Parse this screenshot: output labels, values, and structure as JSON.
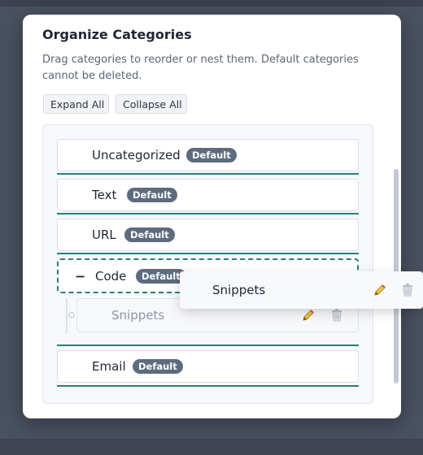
{
  "dialog": {
    "title": "Organize Categories",
    "description": "Drag categories to reorder or nest them. Default categories cannot be deleted.",
    "expand_all": "Expand All",
    "collapse_all": "Collapse All"
  },
  "categories": [
    {
      "name": "Uncategorized",
      "badge": "Default"
    },
    {
      "name": "Text",
      "badge": "Default"
    },
    {
      "name": "URL",
      "badge": "Default"
    },
    {
      "name": "Code",
      "badge": "Default",
      "toggle": "−",
      "expanded": true,
      "children": [
        {
          "name": "Snippets"
        }
      ]
    },
    {
      "name": "Email",
      "badge": "Default"
    }
  ],
  "drag_ghost": {
    "name": "Snippets"
  },
  "icons": {
    "edit": "pencil-icon",
    "delete": "trash-icon"
  },
  "colors": {
    "accent": "#2a7f7a",
    "badge": "#5d6b7f",
    "backdrop": "#4a5161"
  }
}
